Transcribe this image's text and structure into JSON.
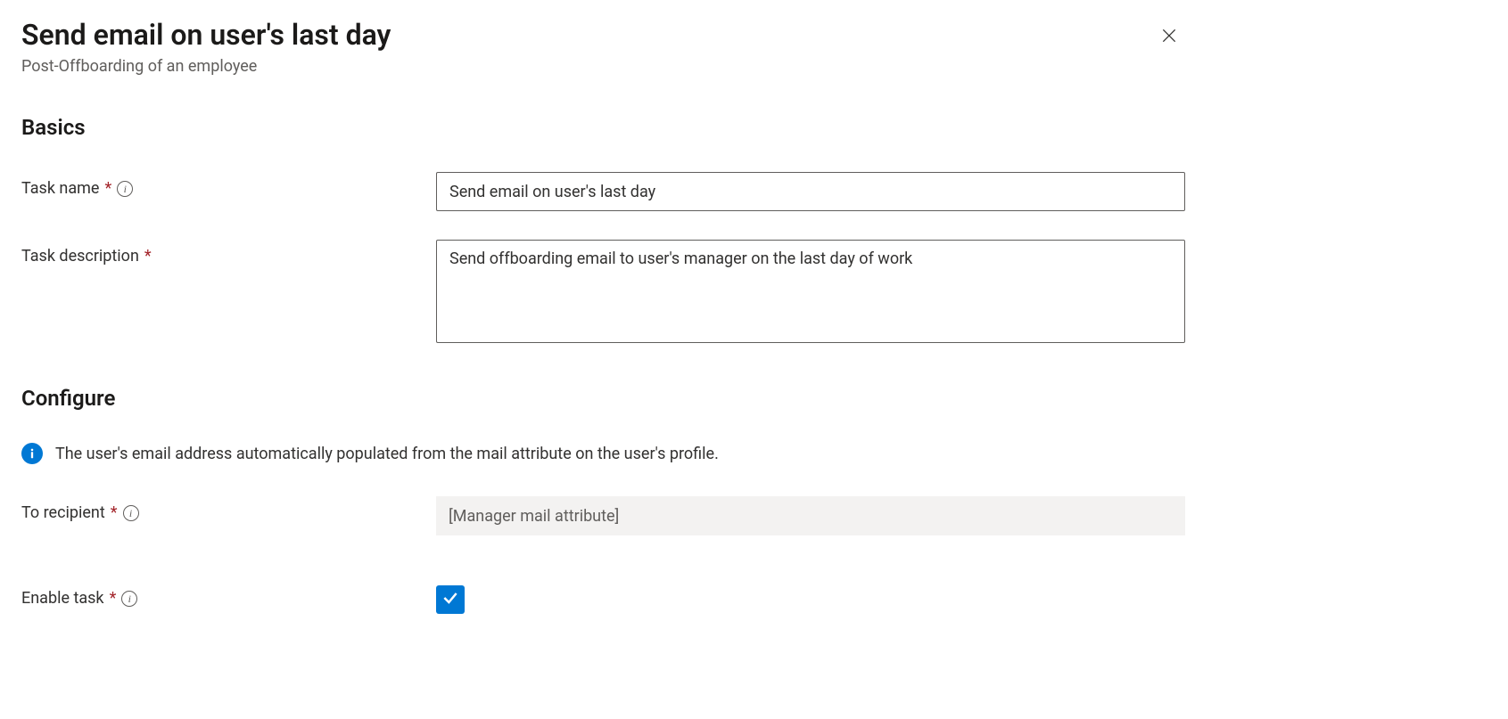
{
  "header": {
    "title": "Send email on user's last day",
    "subtitle": "Post-Offboarding of an employee"
  },
  "sections": {
    "basics": "Basics",
    "configure": "Configure"
  },
  "fields": {
    "task_name": {
      "label": "Task name",
      "value": "Send email on user's last day"
    },
    "task_description": {
      "label": "Task description",
      "value": "Send offboarding email to user's manager on the last day of work"
    },
    "to_recipient": {
      "label": "To recipient",
      "value": "[Manager mail attribute]"
    },
    "enable_task": {
      "label": "Enable task",
      "checked": true
    }
  },
  "info_message": "The user's email address automatically populated from the mail attribute on the user's profile."
}
